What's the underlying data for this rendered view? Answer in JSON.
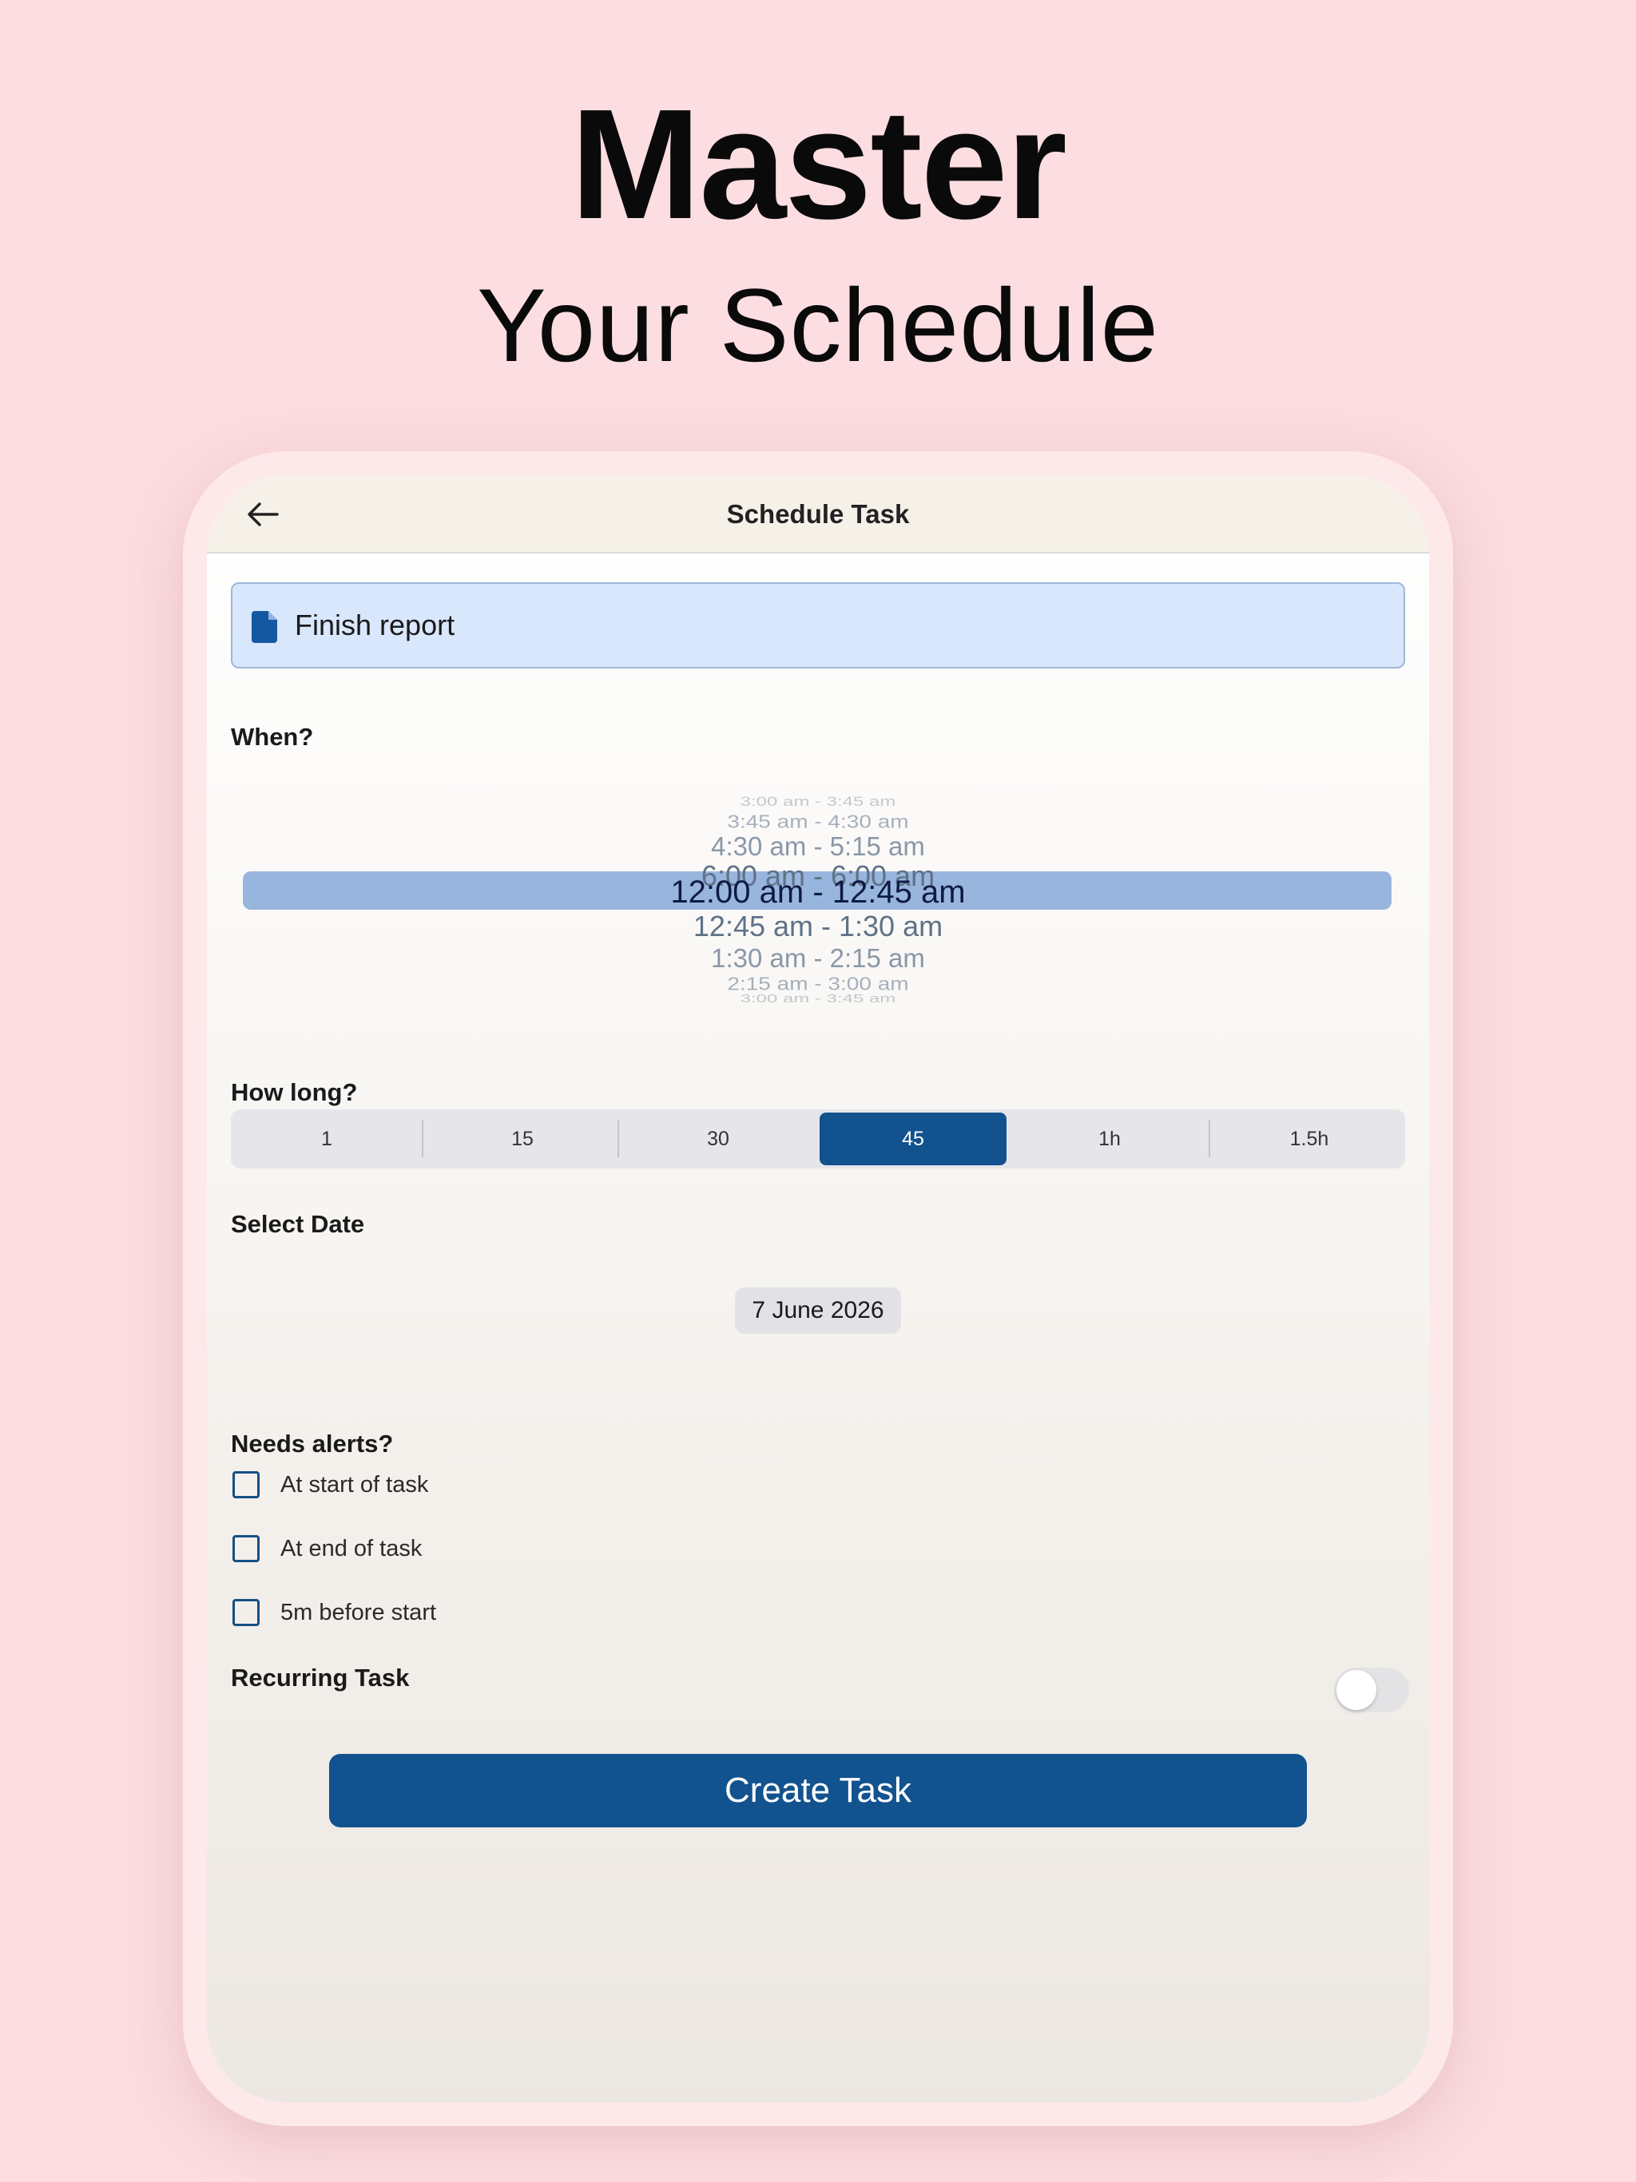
{
  "marketing": {
    "title": "Master",
    "subtitle": "Your Schedule"
  },
  "header": {
    "title": "Schedule Task",
    "back_icon": "arrow-left-icon"
  },
  "task": {
    "name": "Finish report",
    "icon": "document-icon"
  },
  "when": {
    "label": "When?",
    "options": [
      "3:00 am - 3:45 am",
      "3:45 am - 4:30 am",
      "4:30 am - 5:15 am",
      "6:00 am - 6:00 am",
      "12:00 am - 12:45 am",
      "12:45 am - 1:30 am",
      "1:30 am - 2:15 am",
      "2:15 am - 3:00 am",
      "3:00 am - 3:45 am"
    ],
    "selected": "12:00 am - 12:45 am"
  },
  "duration": {
    "label": "How long?",
    "options": [
      "1",
      "15",
      "30",
      "45",
      "1h",
      "1.5h"
    ],
    "selected": "45"
  },
  "date": {
    "label": "Select Date",
    "value": "7 June 2026"
  },
  "alerts": {
    "label": "Needs alerts?",
    "options": [
      {
        "label": "At start of task",
        "checked": false
      },
      {
        "label": "At end of task",
        "checked": false
      },
      {
        "label": "5m before start",
        "checked": false
      }
    ]
  },
  "recurring": {
    "label": "Recurring Task",
    "enabled": false
  },
  "actions": {
    "create_label": "Create Task"
  },
  "colors": {
    "background": "#fcdde1",
    "accent": "#12528f",
    "task_field": "#d8e7fc",
    "picker_highlight": "#98b5dd"
  }
}
